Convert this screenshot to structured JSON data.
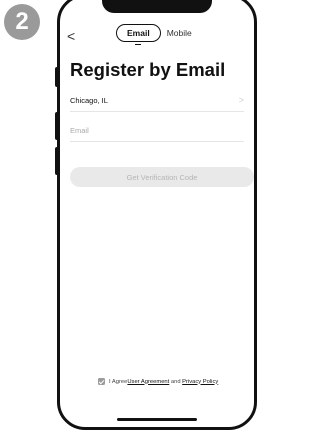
{
  "step_number": "2",
  "header": {
    "back_glyph": "<",
    "tabs": [
      {
        "label": "Email",
        "active": true
      },
      {
        "label": "Mobile",
        "active": false
      }
    ]
  },
  "page_title": "Register by Email",
  "form": {
    "region_value": "Chicago, IL",
    "email_placeholder": "Email",
    "chevron_glyph": ">",
    "get_code_label": "Get Verification Code"
  },
  "agreement": {
    "checked": true,
    "prefix": "I Agree ",
    "user_agreement": "User Agreement",
    "and": " and ",
    "privacy_policy": "Privacy Policy"
  },
  "colors": {
    "badge": "#9a9a9a",
    "button_disabled": "#e9e9e9"
  }
}
